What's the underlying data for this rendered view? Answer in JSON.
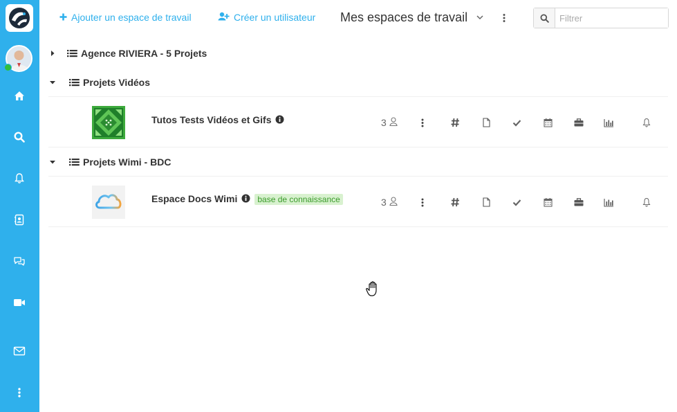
{
  "colors": {
    "accent": "#2fb0ec",
    "presence": "#2fbe3c",
    "tag_bg": "#d8f1cf",
    "tag_fg": "#3a9b2a"
  },
  "sidebar": {
    "items": [
      {
        "icon": "home-icon"
      },
      {
        "icon": "search-icon"
      },
      {
        "icon": "bell-icon"
      },
      {
        "icon": "contacts-icon"
      },
      {
        "icon": "chat-icon"
      },
      {
        "icon": "video-icon"
      },
      {
        "icon": "mail-icon"
      },
      {
        "icon": "more-icon"
      }
    ]
  },
  "toolbar": {
    "add_workspace": "Ajouter un espace de travail",
    "create_user": "Créer un utilisateur",
    "title": "Mes espaces de travail",
    "filter_placeholder": "Filtrer"
  },
  "groups": [
    {
      "label": "Agence RIVIERA - 5 Projets",
      "expanded": false,
      "workspaces": []
    },
    {
      "label": "Projets Vidéos",
      "expanded": true,
      "workspaces": [
        {
          "name": "Tutos Tests Vidéos et Gifs",
          "members": "3",
          "tag": ""
        }
      ]
    },
    {
      "label": "Projets Wimi - BDC",
      "expanded": true,
      "workspaces": [
        {
          "name": "Espace Docs Wimi",
          "members": "3",
          "tag": "base de connaissance"
        }
      ]
    }
  ]
}
